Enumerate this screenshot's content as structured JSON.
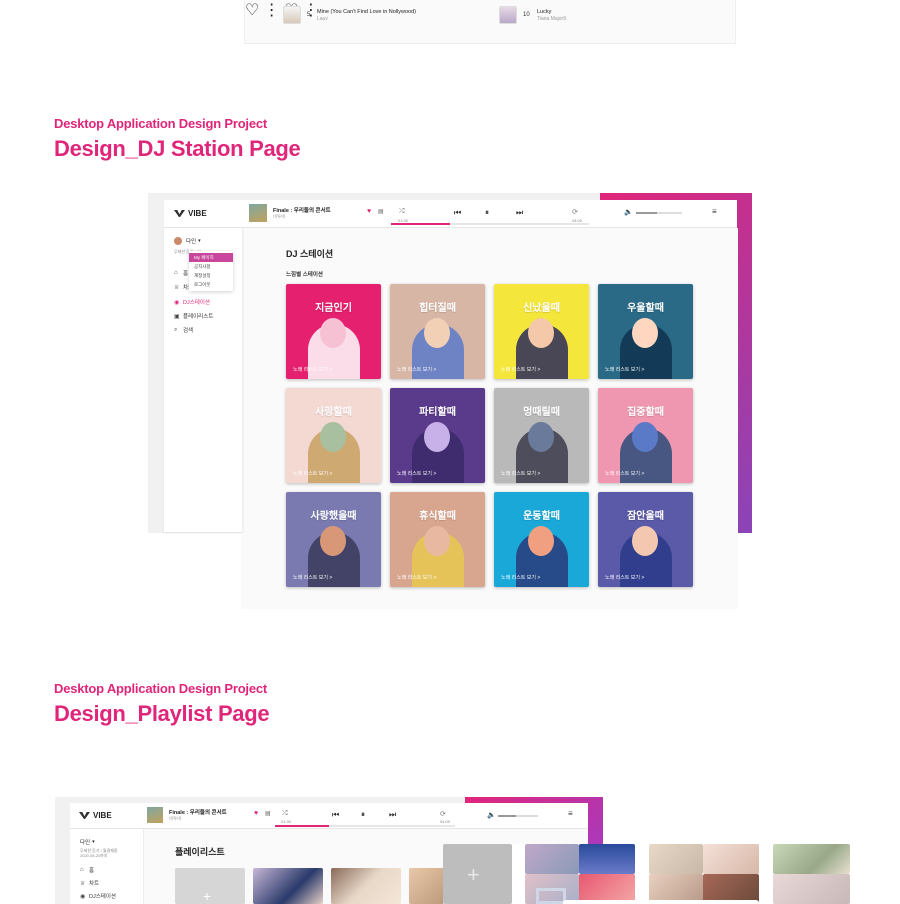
{
  "top_strip": {
    "tracks": [
      {
        "num": "5",
        "title": "Mine (You Can't Find Love in Nollywood)",
        "artist": "Lauv"
      },
      {
        "num": "10",
        "title": "Lucky",
        "artist": "Tiana Major9"
      }
    ]
  },
  "section_dj": {
    "kicker": "Desktop Application Design Project",
    "title": "Design_DJ Station Page"
  },
  "section_playlist": {
    "kicker": "Desktop Application Design Project",
    "title": "Design_Playlist Page"
  },
  "app": {
    "logo": "VIBE",
    "now_playing": {
      "title": "Finale : 우리들의 콘서트",
      "artist": "비투비"
    },
    "time_elapsed": "01:30",
    "time_total": "04:00",
    "progress": 0.3,
    "volume": 0.45
  },
  "dj_sidebar": {
    "user_name": "다인",
    "user_sub": "무제한 듣기 / 20...",
    "dropdown": [
      "My 페이지",
      "공지사항",
      "계정설정",
      "로그아웃"
    ],
    "items": [
      "홈",
      "차트",
      "DJ스테이션",
      "플레이리스트",
      "검색"
    ],
    "active": "DJ스테이션"
  },
  "dj_main": {
    "title": "DJ 스테이션",
    "subtitle": "느낌별 스테이션",
    "cards": [
      {
        "label": "지금인기",
        "more": "노래 리스트 보기 >",
        "bg": "#e5206e"
      },
      {
        "label": "힙터질때",
        "more": "노래 리스트 보기 >",
        "bg": "#d7b6a6"
      },
      {
        "label": "신났을때",
        "more": "노래 리스트 보기 >",
        "bg": "#f5e63c"
      },
      {
        "label": "우울할때",
        "more": "노래 리스트 보기 >",
        "bg": "#2a6a86"
      },
      {
        "label": "사랑할때",
        "more": "노래 리스트 보기 >",
        "bg": "#f4d9d3"
      },
      {
        "label": "파티할때",
        "more": "노래 리스트 보기 >",
        "bg": "#5a3a8a"
      },
      {
        "label": "멍때릴때",
        "more": "노래 리스트 보기 >",
        "bg": "#b9b9b9"
      },
      {
        "label": "집중할때",
        "more": "노래 리스트 보기 >",
        "bg": "#ef97b0"
      },
      {
        "label": "사랑했을때",
        "more": "노래 리스트 보기 >",
        "bg": "#7a7ab0"
      },
      {
        "label": "휴식할때",
        "more": "노래 리스트 보기 >",
        "bg": "#d8a58e"
      },
      {
        "label": "운동할때",
        "more": "노래 리스트 보기 >",
        "bg": "#19a8d8"
      },
      {
        "label": "잠안올때",
        "more": "노래 리스트 보기 >",
        "bg": "#5a5aa8"
      }
    ]
  },
  "pl_app": {
    "logo": "VIBE",
    "now_playing": {
      "title": "Finale : 우리들의 콘서트",
      "artist": "비투비"
    },
    "user_name": "다인",
    "user_sub": "무제한 듣기 / 월결제중",
    "user_date": "2020.05.20까지",
    "items": [
      "홈",
      "차트",
      "DJ스테이션"
    ],
    "title": "플레이리스트"
  },
  "colors": {
    "accent": "#e0267a",
    "grad_end": "#8a44b8"
  }
}
